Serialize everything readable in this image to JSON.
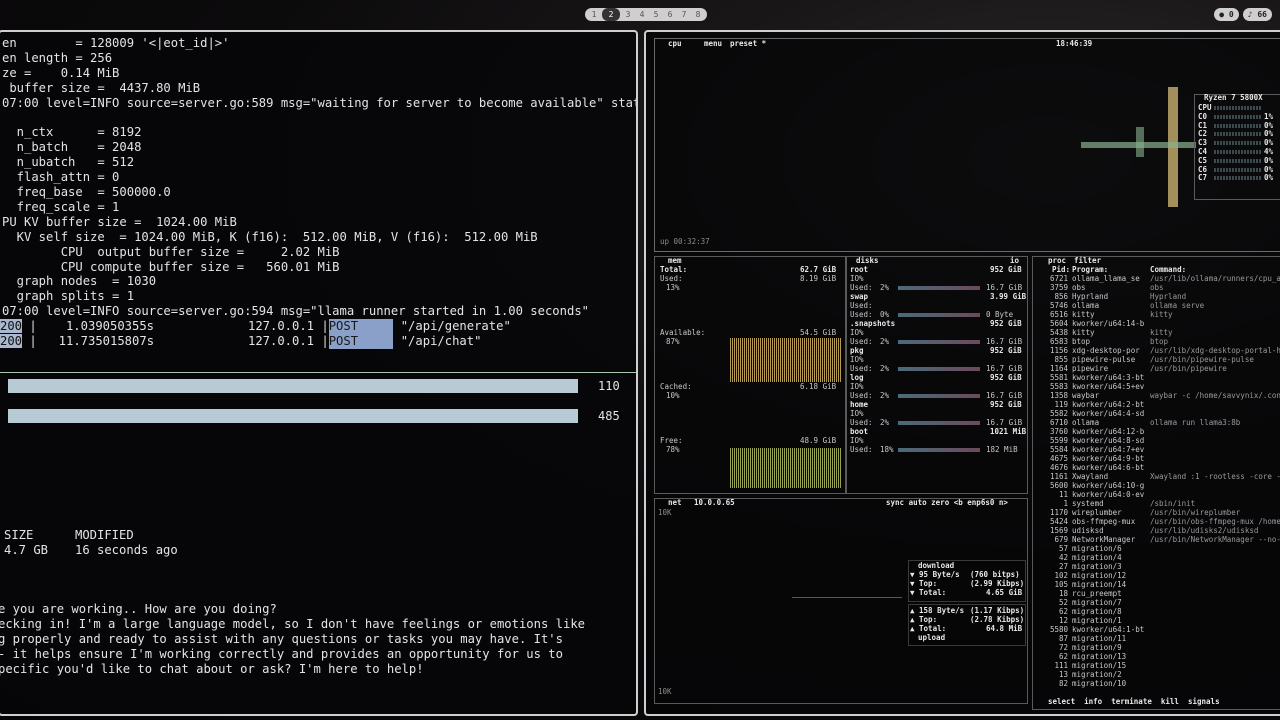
{
  "workspaces": [
    "1",
    "2",
    "3",
    "4",
    "5",
    "6",
    "7",
    "8"
  ],
  "tray": {
    "notif": "0",
    "volume": "66"
  },
  "terminal": {
    "lines": [
      "en        = 128009 '<|eot_id|>'",
      "en length = 256",
      "ze =    0.14 MiB",
      " buffer size =  4437.80 MiB",
      "07:00 level=INFO source=server.go:589 msg=\"waiting for server to become available\" stat",
      "",
      "  n_ctx      = 8192",
      "  n_batch    = 2048",
      "  n_ubatch   = 512",
      "  flash_attn = 0",
      "  freq_base  = 500000.0",
      "  freq_scale = 1",
      "PU KV buffer size =  1024.00 MiB",
      "  KV self size  = 1024.00 MiB, K (f16):  512.00 MiB, V (f16):  512.00 MiB",
      "        CPU  output buffer size =     2.02 MiB",
      "        CPU compute buffer size =   560.01 MiB",
      "  graph nodes  = 1030",
      "  graph splits = 1",
      "07:00 level=INFO source=server.go:594 msg=\"llama runner started in 1.00 seconds\""
    ],
    "requests": [
      {
        "code": "200",
        "time": "1.039050355s",
        "ip": "127.0.0.1",
        "method": "POST",
        "path": "\"/api/generate\""
      },
      {
        "code": "200",
        "time": "11.735015807s",
        "ip": "127.0.0.1",
        "method": "POST",
        "path": "\"/api/chat\""
      }
    ],
    "bars": [
      {
        "value": "110"
      },
      {
        "value": "485"
      }
    ],
    "list_header": {
      "size": "SIZE",
      "modified": "MODIFIED"
    },
    "list_row": {
      "size": "4.7 GB",
      "modified": "16 seconds ago"
    },
    "chat": [
      "e you are working.. How are you doing?",
      "ecking in! I'm a large language model, so I don't have feelings or emotions like",
      "g properly and ready to assist with any questions or tasks you may have. It's",
      "- it helps ensure I'm working correctly and provides an opportunity for us to",
      "pecific you'd like to chat about or ask? I'm here to help!"
    ]
  },
  "btop": {
    "tabs": {
      "cpu": "cpu",
      "menu": "menu",
      "preset": "preset *"
    },
    "clock": "18:46:39",
    "uptime": "up 00:32:37",
    "cpu_model": "Ryzen 7 5800X",
    "cpu_rows": [
      "CPU",
      "C0",
      "C1",
      "C2",
      "C3",
      "C4",
      "C5",
      "C6",
      "C7"
    ],
    "cpu_pcts": [
      "",
      "1%",
      "0%",
      "0%",
      "0%",
      "4%",
      "0%",
      "0%",
      "0%"
    ],
    "mem": {
      "title": "mem",
      "total_label": "Total:",
      "total": "62.7 GiB",
      "used_label": "Used:",
      "used": "8.19 GiB",
      "used_pct": "13%",
      "avail_label": "Available:",
      "avail": "54.5 GiB",
      "avail_pct": "87%",
      "cached_label": "Cached:",
      "cached": "6.18 GiB",
      "cached_pct": "10%",
      "free_label": "Free:",
      "free": "48.9 GiB",
      "free_pct": "78%"
    },
    "disks": {
      "title": "disks",
      "io": "io",
      "items": [
        {
          "name": "root",
          "size": "952 GiB",
          "io": "IO%",
          "used_pct": "2%",
          "used": "16.7 GiB",
          "free_label": "Used:"
        },
        {
          "name": "swap",
          "size": "3.99 GiB",
          "io": "Used:",
          "used_pct": "0%",
          "used": "0 Byte",
          "free_label": "Used:"
        },
        {
          "name": ".snapshots",
          "size": "952 GiB",
          "io": "IO%",
          "used_pct": "2%",
          "used": "16.7 GiB",
          "free_label": "Used:"
        },
        {
          "name": "pkg",
          "size": "952 GiB",
          "io": "IO%",
          "used_pct": "2%",
          "used": "16.7 GiB",
          "free_label": "Used:"
        },
        {
          "name": "log",
          "size": "952 GiB",
          "io": "IO%",
          "used_pct": "2%",
          "used": "16.7 GiB",
          "free_label": "Used:"
        },
        {
          "name": "home",
          "size": "952 GiB",
          "io": "IO%",
          "used_pct": "2%",
          "used": "16.7 GiB",
          "free_label": "Used:"
        },
        {
          "name": "boot",
          "size": "1021 MiB",
          "io": "IO%",
          "used_pct": "18%",
          "used": "182 MiB",
          "free_label": "Used:"
        }
      ]
    },
    "net": {
      "title": "net",
      "ip": "10.0.0.65",
      "controls": "sync auto zero <b enp6s0 n>",
      "scale_top": "10K",
      "scale_bottom": "10K",
      "download_label": "download",
      "dl_rate": "95 Byte/s",
      "dl_bits": "(760 bitps)",
      "dl_top_label": "Top:",
      "dl_top": "(2.99 Kibps)",
      "dl_total_label": "Total:",
      "dl_total": "4.65 GiB",
      "ul_rate": "158 Byte/s",
      "ul_bits": "(1.17 Kibps)",
      "ul_top_label": "Top:",
      "ul_top": "(2.78 Kibps)",
      "ul_total_label": "Total:",
      "ul_total": "64.8 MiB",
      "upload_label": "upload"
    },
    "proc": {
      "title": "proc",
      "filter": "filter",
      "col_pid": "Pid:",
      "col_prog": "Program:",
      "col_cmd": "Command:",
      "footer": "select  info  terminate  kill  signals",
      "rows": [
        {
          "pid": "6721",
          "prog": "ollama_llama_se",
          "cmd": "/usr/lib/ollama/runners/cpu_a"
        },
        {
          "pid": "3759",
          "prog": "obs",
          "cmd": "obs"
        },
        {
          "pid": "856",
          "prog": "Hyprland",
          "cmd": "Hyprland"
        },
        {
          "pid": "5746",
          "prog": "ollama",
          "cmd": "ollama serve"
        },
        {
          "pid": "6516",
          "prog": "kitty",
          "cmd": "kitty"
        },
        {
          "pid": "5604",
          "prog": "kworker/u64:14-b",
          "cmd": ""
        },
        {
          "pid": "5438",
          "prog": "kitty",
          "cmd": "kitty"
        },
        {
          "pid": "6583",
          "prog": "btop",
          "cmd": "btop"
        },
        {
          "pid": "1156",
          "prog": "xdg-desktop-por",
          "cmd": "/usr/lib/xdg-desktop-portal-h"
        },
        {
          "pid": "855",
          "prog": "pipewire-pulse",
          "cmd": "/usr/bin/pipewire-pulse"
        },
        {
          "pid": "1164",
          "prog": "pipewire",
          "cmd": "/usr/bin/pipewire"
        },
        {
          "pid": "5581",
          "prog": "kworker/u64:3-bt",
          "cmd": ""
        },
        {
          "pid": "5583",
          "prog": "kworker/u64:5+ev",
          "cmd": ""
        },
        {
          "pid": "1358",
          "prog": "waybar",
          "cmd": "waybar -c /home/savvynix/.con"
        },
        {
          "pid": "119",
          "prog": "kworker/u64:2-bt",
          "cmd": ""
        },
        {
          "pid": "5582",
          "prog": "kworker/u64:4-sd",
          "cmd": ""
        },
        {
          "pid": "6710",
          "prog": "ollama",
          "cmd": "ollama run llama3:8b"
        },
        {
          "pid": "3760",
          "prog": "kworker/u64:12-b",
          "cmd": ""
        },
        {
          "pid": "5599",
          "prog": "kworker/u64:8-sd",
          "cmd": ""
        },
        {
          "pid": "5584",
          "prog": "kworker/u64:7+ev",
          "cmd": ""
        },
        {
          "pid": "4675",
          "prog": "kworker/u64:9-bt",
          "cmd": ""
        },
        {
          "pid": "4676",
          "prog": "kworker/u64:6-bt",
          "cmd": ""
        },
        {
          "pid": "1161",
          "prog": "Xwayland",
          "cmd": "Xwayland :1 -rootless -core -"
        },
        {
          "pid": "5600",
          "prog": "kworker/u64:10-g",
          "cmd": ""
        },
        {
          "pid": "11",
          "prog": "kworker/u64:0-ev",
          "cmd": ""
        },
        {
          "pid": "1",
          "prog": "systemd",
          "cmd": "/sbin/init"
        },
        {
          "pid": "1170",
          "prog": "wireplumber",
          "cmd": "/usr/bin/wireplumber"
        },
        {
          "pid": "5424",
          "prog": "obs-ffmpeg-mux",
          "cmd": "/usr/bin/obs-ffmpeg-mux /home"
        },
        {
          "pid": "1569",
          "prog": "udisksd",
          "cmd": "/usr/lib/udisks2/udisksd"
        },
        {
          "pid": "679",
          "prog": "NetworkManager",
          "cmd": "/usr/bin/NetworkManager --no-"
        },
        {
          "pid": "57",
          "prog": "migration/6",
          "cmd": ""
        },
        {
          "pid": "42",
          "prog": "migration/4",
          "cmd": ""
        },
        {
          "pid": "27",
          "prog": "migration/3",
          "cmd": ""
        },
        {
          "pid": "102",
          "prog": "migration/12",
          "cmd": ""
        },
        {
          "pid": "105",
          "prog": "migration/14",
          "cmd": ""
        },
        {
          "pid": "18",
          "prog": "rcu_preempt",
          "cmd": ""
        },
        {
          "pid": "52",
          "prog": "migration/7",
          "cmd": ""
        },
        {
          "pid": "62",
          "prog": "migration/8",
          "cmd": ""
        },
        {
          "pid": "12",
          "prog": "migration/1",
          "cmd": ""
        },
        {
          "pid": "5580",
          "prog": "kworker/u64:1-bt",
          "cmd": ""
        },
        {
          "pid": "87",
          "prog": "migration/11",
          "cmd": ""
        },
        {
          "pid": "72",
          "prog": "migration/9",
          "cmd": ""
        },
        {
          "pid": "62",
          "prog": "migration/13",
          "cmd": ""
        },
        {
          "pid": "111",
          "prog": "migration/15",
          "cmd": ""
        },
        {
          "pid": "13",
          "prog": "migration/2",
          "cmd": ""
        },
        {
          "pid": "82",
          "prog": "migration/10",
          "cmd": ""
        }
      ]
    }
  }
}
